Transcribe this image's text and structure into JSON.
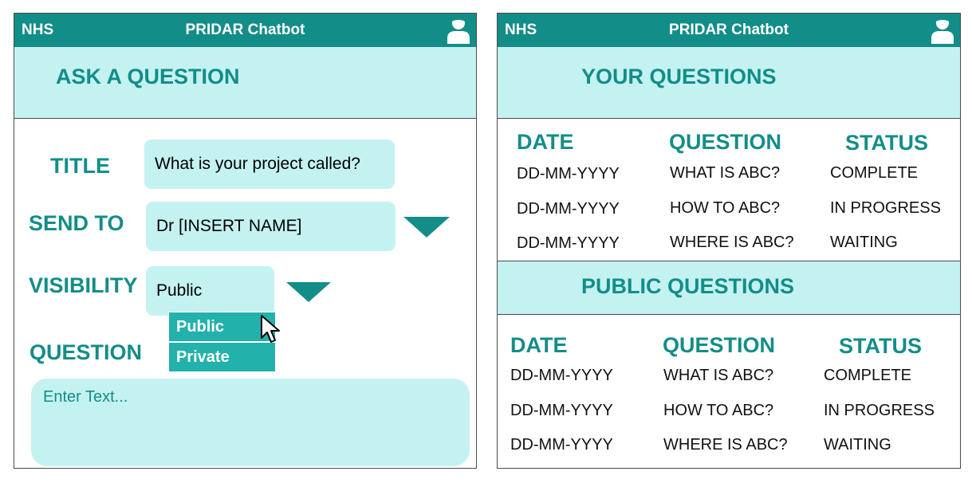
{
  "left": {
    "header": {
      "brand": "NHS",
      "title": "PRIDAR Chatbot"
    },
    "section_title": "ASK A QUESTION",
    "form": {
      "title_label": "TITLE",
      "title_value": "What is your project called?",
      "send_to_label": "SEND TO",
      "send_to_value": "Dr [INSERT NAME]",
      "visibility_label": "VISIBILITY",
      "visibility_value": "Public",
      "visibility_options": [
        "Public",
        "Private"
      ],
      "question_label": "QUESTION",
      "question_placeholder": "Enter Text..."
    }
  },
  "right": {
    "header": {
      "brand": "NHS",
      "title": "PRIDAR Chatbot"
    },
    "your_questions": {
      "title": "YOUR QUESTIONS",
      "columns": [
        "DATE",
        "QUESTION",
        "STATUS"
      ],
      "rows": [
        [
          "DD-MM-YYYY",
          "WHAT IS ABC?",
          "COMPLETE"
        ],
        [
          "DD-MM-YYYY",
          "HOW TO ABC?",
          "IN PROGRESS"
        ],
        [
          "DD-MM-YYYY",
          "WHERE IS ABC?",
          "WAITING"
        ]
      ]
    },
    "public_questions": {
      "title": "PUBLIC QUESTIONS",
      "columns": [
        "DATE",
        "QUESTION",
        "STATUS"
      ],
      "rows": [
        [
          "DD-MM-YYYY",
          "WHAT IS ABC?",
          "COMPLETE"
        ],
        [
          "DD-MM-YYYY",
          "HOW TO ABC?",
          "IN PROGRESS"
        ],
        [
          "DD-MM-YYYY",
          "WHERE IS ABC?",
          "WAITING"
        ]
      ]
    }
  },
  "icons": {
    "avatar": "user-avatar-icon",
    "dropdown": "triangle-down-icon",
    "pointer": "mouse-pointer-icon"
  },
  "colors": {
    "accent": "#138d88",
    "light": "#c4f2f1",
    "option": "#23b1ab"
  }
}
